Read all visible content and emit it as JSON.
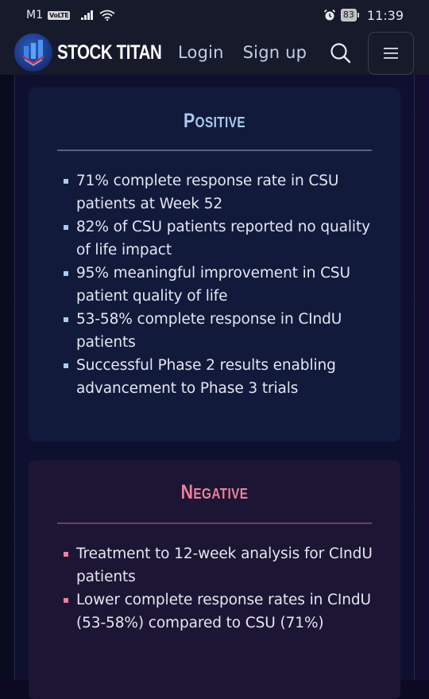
{
  "status_bar": {
    "carrier": "M1",
    "volte_badge": "VoLTE",
    "battery_level": "83",
    "time": "11:39"
  },
  "navbar": {
    "brand": "STOCK TITAN",
    "login_label": "Login",
    "signup_label": "Sign up",
    "search_icon": "search-icon",
    "menu_icon": "hamburger-menu-icon"
  },
  "colors": {
    "positive_accent": "#a9cbee",
    "negative_accent": "#f07ea0",
    "background": "#0f1030"
  },
  "positive": {
    "title": "Positive",
    "items": [
      "71% complete response rate in CSU patients at Week 52",
      "82% of CSU patients reported no quality of life impact",
      "95% meaningful improvement in CSU patient quality of life",
      "53-58% complete response in CIndU patients",
      "Successful Phase 2 results enabling advancement to Phase 3 trials"
    ]
  },
  "negative": {
    "title": "Negative",
    "items": [
      "Treatment to 12-week analysis for CIndU patients",
      "Lower complete response rates in CIndU (53-58%) compared to CSU (71%)"
    ]
  }
}
